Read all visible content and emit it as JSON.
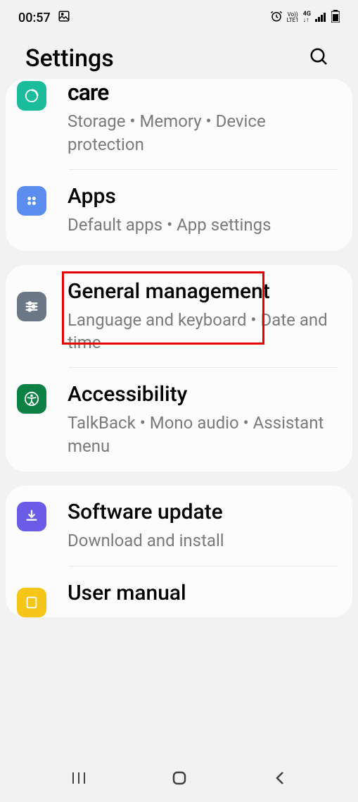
{
  "status": {
    "time": "00:57",
    "network_label": "4G",
    "lte_label": "LTE1",
    "volte_label": "Vo))"
  },
  "header": {
    "title": "Settings"
  },
  "groups": [
    {
      "items": [
        {
          "id": "care",
          "title": "care",
          "subtitle": "Storage  •  Memory  •  Device protection",
          "icon_color": "teal"
        },
        {
          "id": "apps",
          "title": "Apps",
          "subtitle": "Default apps  •  App settings",
          "icon_color": "blue"
        }
      ]
    },
    {
      "items": [
        {
          "id": "general_management",
          "title": "General management",
          "subtitle": "Language and keyboard  •  Date and time",
          "icon_color": "gray",
          "highlighted": true
        },
        {
          "id": "accessibility",
          "title": "Accessibility",
          "subtitle": "TalkBack  •  Mono audio  •  Assistant menu",
          "icon_color": "green"
        }
      ]
    },
    {
      "items": [
        {
          "id": "software_update",
          "title": "Software update",
          "subtitle": "Download and install",
          "icon_color": "purple"
        },
        {
          "id": "user_manual",
          "title": "User manual",
          "subtitle": "",
          "icon_color": "yellow"
        }
      ]
    }
  ]
}
